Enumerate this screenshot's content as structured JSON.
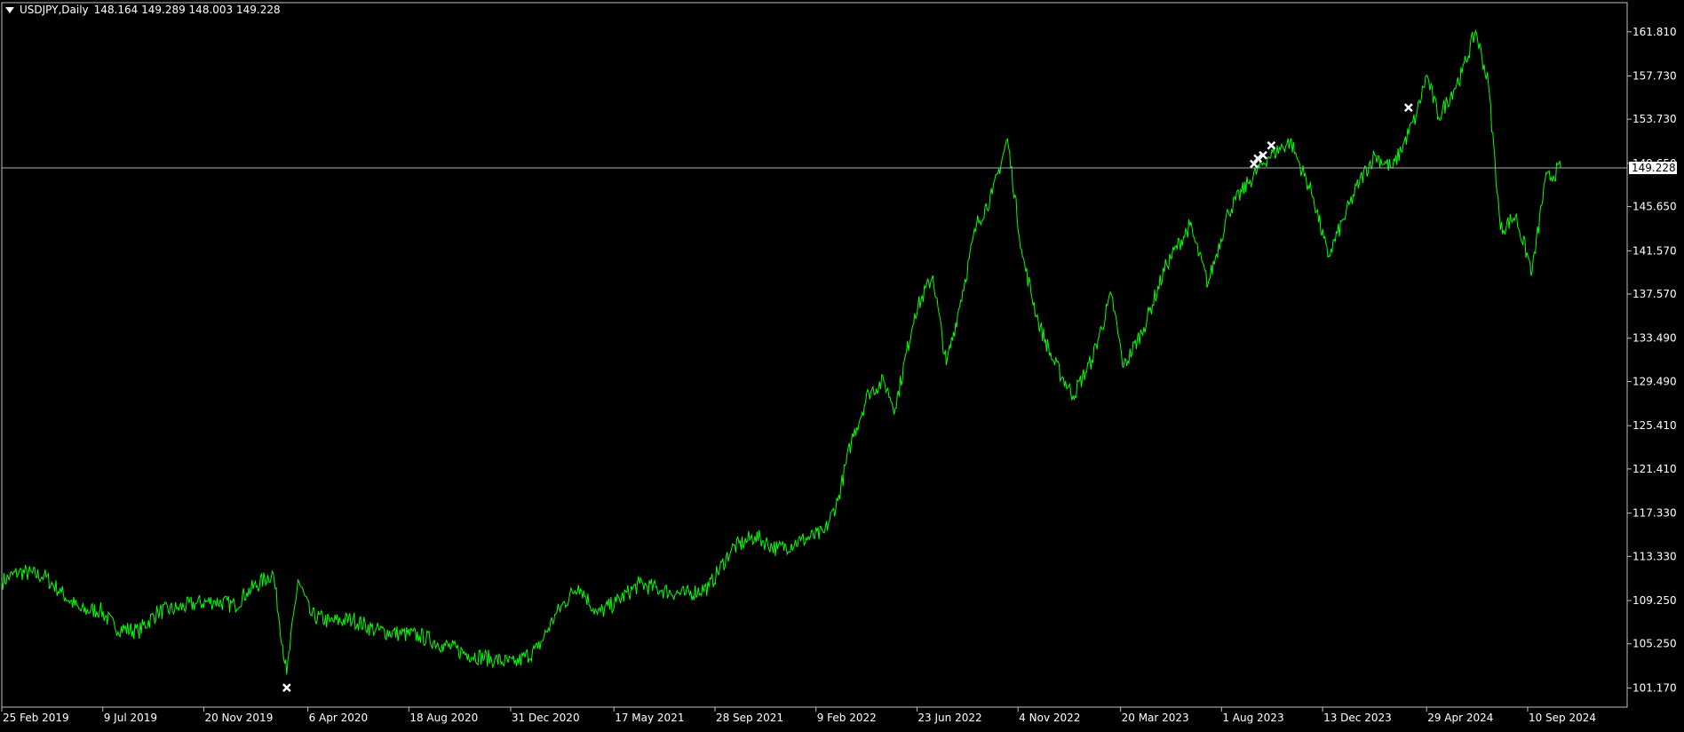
{
  "window": {
    "symbol_label": "USDJPY,Daily",
    "ohlc_label": "148.164 149.289 148.003 149.228",
    "current_price_label": "149.228"
  },
  "colors": {
    "background": "#000000",
    "price_line": "#00ff00",
    "axis": "#c0c0c0",
    "text": "#ffffff",
    "marker": "#ffffff",
    "bid_line": "#a8b4b8"
  },
  "chart_data": {
    "type": "line",
    "title": "USDJPY,Daily",
    "xlabel": "",
    "ylabel": "",
    "ylim": [
      99.4,
      164.5
    ],
    "grid": false,
    "y_ticks": [
      "161.810",
      "157.730",
      "153.730",
      "149.650",
      "145.650",
      "141.570",
      "137.570",
      "133.490",
      "129.490",
      "125.410",
      "121.410",
      "117.330",
      "113.330",
      "109.250",
      "105.250",
      "101.170"
    ],
    "x_ticks": [
      "25 Feb 2019",
      "9 Jul 2019",
      "20 Nov 2019",
      "6 Apr 2020",
      "18 Aug 2020",
      "31 Dec 2020",
      "17 May 2021",
      "28 Sep 2021",
      "9 Feb 2022",
      "23 Jun 2022",
      "4 Nov 2022",
      "20 Mar 2023",
      "1 Aug 2023",
      "13 Dec 2023",
      "29 Apr 2024",
      "10 Sep 2024"
    ],
    "x_domain": [
      "2019-02-25",
      "2025-01-20"
    ],
    "series": [
      {
        "x": [
          "2019-02-25",
          "2019-03-20",
          "2019-04-22",
          "2019-05-15",
          "2019-06-10",
          "2019-07-05",
          "2019-07-25",
          "2019-08-25",
          "2019-09-20",
          "2019-10-15",
          "2019-11-10",
          "2019-12-05",
          "2019-12-31",
          "2020-01-16",
          "2020-02-20",
          "2020-03-09",
          "2020-03-24",
          "2020-04-10",
          "2020-05-05",
          "2020-06-05",
          "2020-07-05",
          "2020-08-05",
          "2020-09-01",
          "2020-10-01",
          "2020-11-05",
          "2020-12-10",
          "2021-01-05",
          "2021-02-05",
          "2021-03-01",
          "2021-03-31",
          "2021-04-25",
          "2021-05-20",
          "2021-06-20",
          "2021-07-20",
          "2021-08-20",
          "2021-09-20",
          "2021-10-20",
          "2021-11-20",
          "2021-12-20",
          "2022-01-20",
          "2022-02-20",
          "2022-03-10",
          "2022-03-28",
          "2022-04-20",
          "2022-05-10",
          "2022-05-25",
          "2022-06-20",
          "2022-07-14",
          "2022-08-01",
          "2022-08-20",
          "2022-09-10",
          "2022-10-01",
          "2022-10-21",
          "2022-11-10",
          "2022-12-01",
          "2022-12-20",
          "2023-01-16",
          "2023-02-10",
          "2023-03-08",
          "2023-03-24",
          "2023-04-20",
          "2023-05-20",
          "2023-06-20",
          "2023-07-14",
          "2023-08-10",
          "2023-09-05",
          "2023-10-01",
          "2023-10-31",
          "2023-11-13",
          "2023-12-01",
          "2023-12-20",
          "2024-01-10",
          "2024-01-31",
          "2024-02-20",
          "2024-03-15",
          "2024-04-15",
          "2024-04-29",
          "2024-05-15",
          "2024-06-15",
          "2024-07-03",
          "2024-07-20",
          "2024-08-05",
          "2024-08-25",
          "2024-09-16",
          "2024-10-03",
          "2024-10-24"
        ],
        "values": [
          111.0,
          111.9,
          111.5,
          110.0,
          108.3,
          108.4,
          106.8,
          106.4,
          108.2,
          108.5,
          109.0,
          109.2,
          108.8,
          110.0,
          111.8,
          102.4,
          111.2,
          107.9,
          107.3,
          107.5,
          106.5,
          106.2,
          106.0,
          105.2,
          104.3,
          103.8,
          103.4,
          104.8,
          108.0,
          110.7,
          108.0,
          109.1,
          110.8,
          110.2,
          109.8,
          110.5,
          114.0,
          115.2,
          114.0,
          114.8,
          115.5,
          118.5,
          124.0,
          128.5,
          129.5,
          127.0,
          135.8,
          139.3,
          131.0,
          137.0,
          144.0,
          146.8,
          151.9,
          141.0,
          135.0,
          131.5,
          128.2,
          131.5,
          137.5,
          130.8,
          134.5,
          140.3,
          143.9,
          138.5,
          145.2,
          147.8,
          150.2,
          151.7,
          149.5,
          146.5,
          141.0,
          144.5,
          148.0,
          150.4,
          149.2,
          154.0,
          157.8,
          153.9,
          158.0,
          161.9,
          157.0,
          143.5,
          144.8,
          139.6,
          148.0,
          149.228
        ]
      }
    ],
    "markers": [
      {
        "x": "2020-03-09",
        "y": 101.2
      },
      {
        "x": "2023-09-13",
        "y": 149.6
      },
      {
        "x": "2023-09-18",
        "y": 150.1
      },
      {
        "x": "2023-09-25",
        "y": 150.4
      },
      {
        "x": "2023-10-06",
        "y": 151.3
      },
      {
        "x": "2024-04-05",
        "y": 154.8
      }
    ],
    "current_price": 149.228
  }
}
